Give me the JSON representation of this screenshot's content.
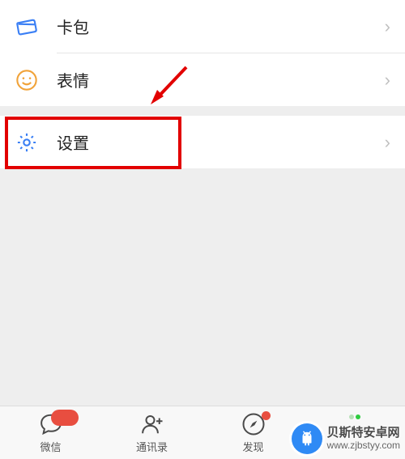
{
  "menu": {
    "card_pack": {
      "label": "卡包"
    },
    "stickers": {
      "label": "表情"
    },
    "settings": {
      "label": "设置"
    }
  },
  "tabbar": {
    "chats": {
      "label": "微信"
    },
    "contacts": {
      "label": "通讯录"
    },
    "discover": {
      "label": "发现"
    },
    "me": {
      "label": ""
    }
  },
  "colors": {
    "icon_blue": "#3a7ff5",
    "icon_orange": "#f1a33a",
    "icon_settings": "#3a7ff5",
    "highlight": "#e20000",
    "tab_inactive": "#4a4a4a",
    "badge": "#e84e40",
    "dot_green": "#2ecc40"
  },
  "watermark": {
    "line1": "贝斯特安卓网",
    "line2": "www.zjbstyy.com"
  }
}
